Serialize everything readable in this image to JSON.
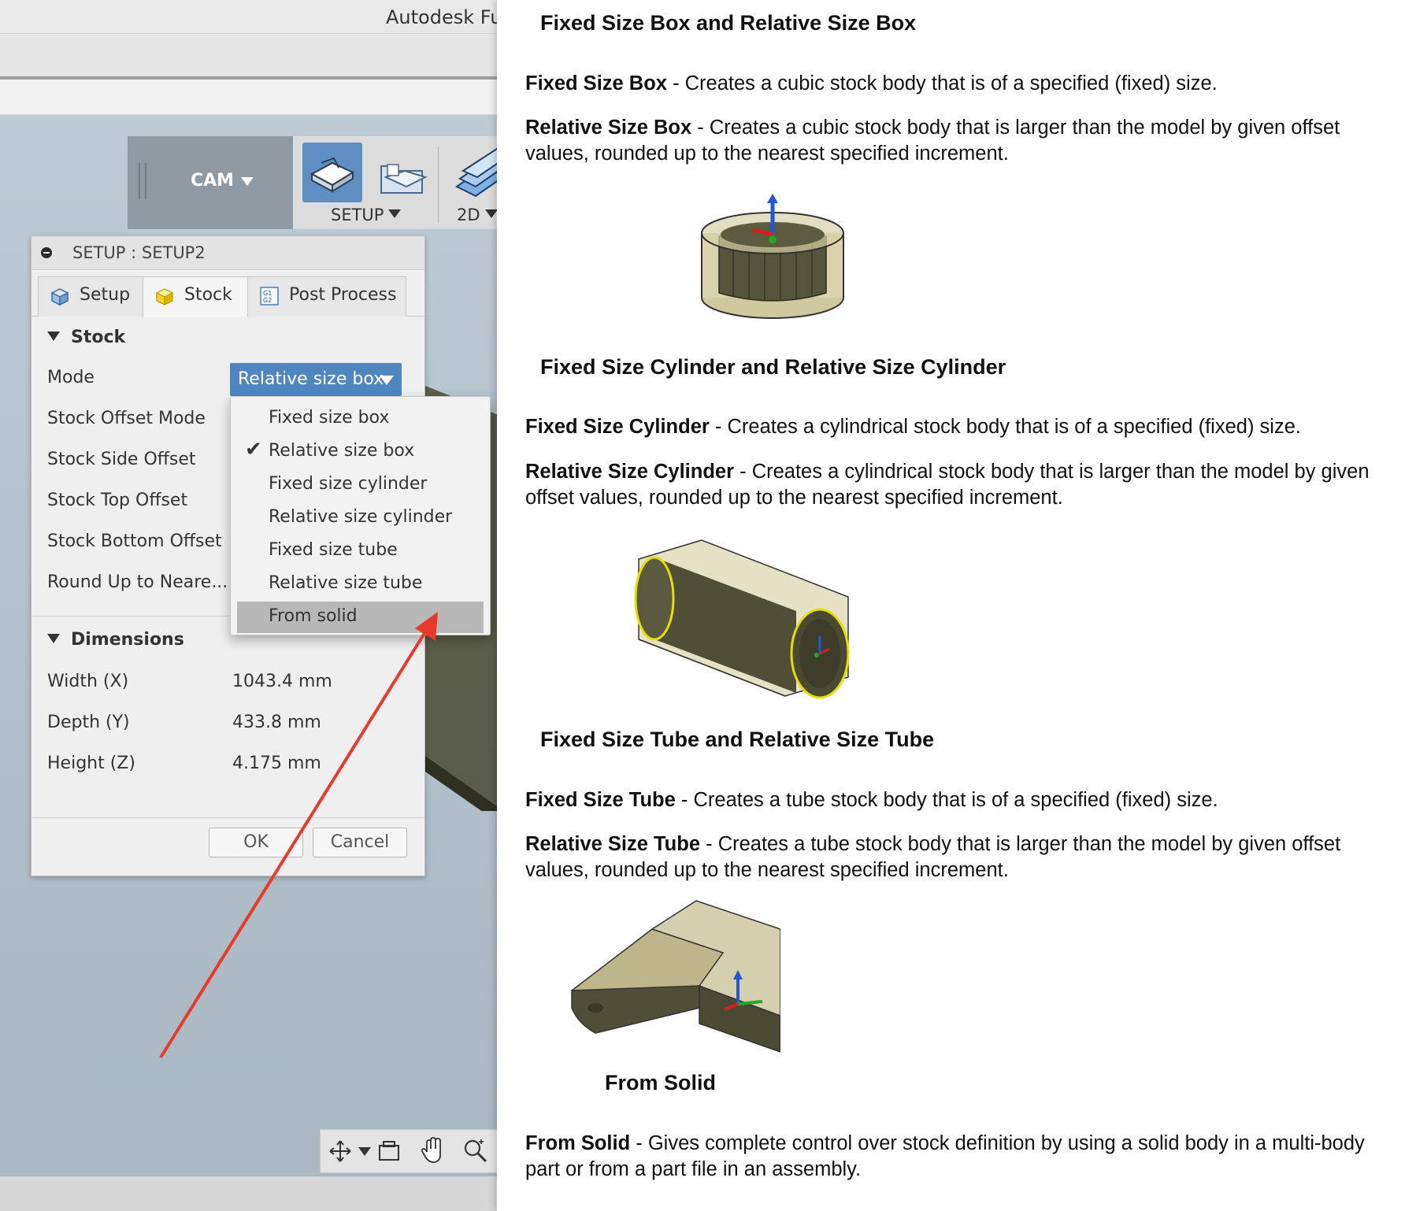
{
  "app": {
    "title": "Autodesk Fusion",
    "workspace": "CAM",
    "toolbar": {
      "setup_label": "SETUP",
      "twod_label": "2D"
    }
  },
  "dialog": {
    "title": "SETUP : SETUP2",
    "tabs": [
      {
        "label": "Setup",
        "icon": "setup-cube-icon"
      },
      {
        "label": "Stock",
        "icon": "stock-box-icon"
      },
      {
        "label": "Post Process",
        "icon": "gcode-icon"
      }
    ],
    "active_tab": "Stock",
    "stock_section": "Stock",
    "mode_label": "Mode",
    "mode_value": "Relative size box",
    "rows": [
      "Stock Offset Mode",
      "Stock Side Offset",
      "Stock Top Offset",
      "Stock Bottom Offset",
      "Round Up to Neare..."
    ],
    "dimensions_section": "Dimensions",
    "dimensions": [
      {
        "label": "Width (X)",
        "value": "1043.4 mm"
      },
      {
        "label": "Depth (Y)",
        "value": "433.8 mm"
      },
      {
        "label": "Height (Z)",
        "value": "4.175 mm"
      }
    ],
    "ok": "OK",
    "cancel": "Cancel"
  },
  "menu": {
    "options": [
      "Fixed size box",
      "Relative size box",
      "Fixed size cylinder",
      "Relative size cylinder",
      "Fixed size tube",
      "Relative size tube",
      "From solid"
    ],
    "checked": "Relative size box",
    "highlighted": "From solid"
  },
  "navbar": {
    "icons": [
      "orbit-icon",
      "look-at-icon",
      "pan-hand-icon",
      "zoom-icon"
    ]
  },
  "doc": {
    "sections": [
      {
        "heading": "Fixed Size Box and Relative Size Box",
        "items": [
          {
            "term": "Fixed Size Box",
            "text": " - Creates a cubic stock body that is of a specified (fixed) size."
          },
          {
            "term": "Relative Size Box",
            "text": " - Creates a cubic stock body that is larger than the model by given offset values, rounded up to the nearest specified increment."
          }
        ]
      },
      {
        "heading": "Fixed Size Cylinder and Relative Size Cylinder",
        "items": [
          {
            "term": "Fixed Size Cylinder",
            "text": " - Creates a cylindrical stock body that is of a specified (fixed) size."
          },
          {
            "term": "Relative Size Cylinder",
            "text": " - Creates a cylindrical stock body that is larger than the model by given offset values, rounded up to the nearest specified increment."
          }
        ]
      },
      {
        "heading": "Fixed Size Tube and Relative Size Tube",
        "items": [
          {
            "term": "Fixed Size Tube",
            "text": " - Creates a tube stock body that is of a specified (fixed) size."
          },
          {
            "term": "Relative Size Tube",
            "text": " - Creates a tube stock body that is larger than the model by given offset values, rounded up to the nearest specified increment."
          }
        ]
      },
      {
        "heading": "From Solid",
        "items": [
          {
            "term": "From Solid",
            "text": " - Gives complete control over stock definition by using a solid body in a multi-body part or from a part file in an assembly."
          }
        ]
      }
    ]
  },
  "colors": {
    "accent": "#4f86c0",
    "annotation_arrow": "#e8392a",
    "stock_body": "#5a5a3c"
  }
}
